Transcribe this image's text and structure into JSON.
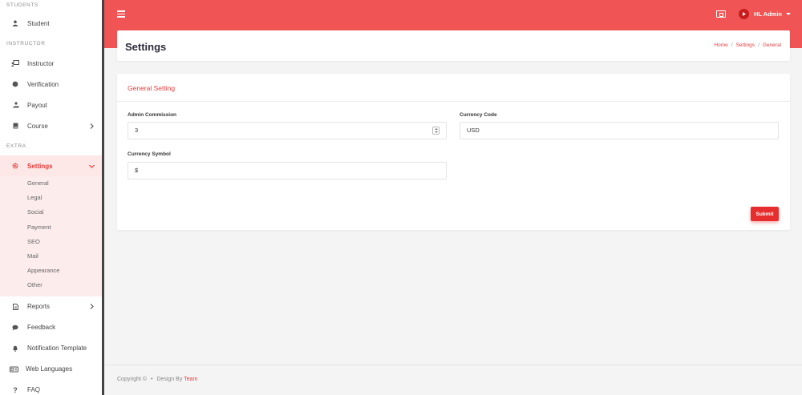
{
  "sidebar": {
    "sections": {
      "students": "STUDENTS",
      "instructor": "INSTRUCTOR",
      "extra": "EXTRA"
    },
    "items": {
      "student": "Student",
      "instructor": "Instructor",
      "verification": "Verification",
      "payout": "Payout",
      "course": "Course",
      "settings": "Settings",
      "reports": "Reports",
      "feedback": "Feedback",
      "notification_template": "Notification Template",
      "web_languages": "Web Languages",
      "faq": "FAQ"
    },
    "settings_submenu": [
      "General",
      "Legal",
      "Social",
      "Payment",
      "SEO",
      "Mail",
      "Appearance",
      "Other"
    ]
  },
  "topbar": {
    "user_name": "HL Admin"
  },
  "page": {
    "title": "Settings",
    "breadcrumb": [
      "Home",
      "Settings",
      "General"
    ]
  },
  "form": {
    "card_title": "General Setting",
    "admin_commission_label": "Admin Commission",
    "admin_commission_value": "3",
    "currency_code_label": "Currency Code",
    "currency_code_value": "USD",
    "currency_symbol_label": "Currency Symbol",
    "currency_symbol_value": "$",
    "submit_label": "Submit"
  },
  "footer": {
    "copyright": "Copyright ©",
    "bullet": "•",
    "design_by": "Design By",
    "team": "Team"
  },
  "colors": {
    "brand": "#f05454",
    "accent": "#e53e3e",
    "submit": "#e62e2e"
  }
}
